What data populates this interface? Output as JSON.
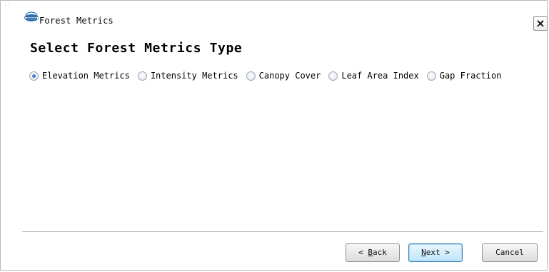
{
  "window": {
    "title": "Forest Metrics",
    "close_label": "×"
  },
  "page": {
    "heading": "Select Forest Metrics Type"
  },
  "metrics_type": {
    "selected": "Elevation Metrics",
    "options": [
      {
        "label": "Elevation Metrics",
        "checked": true
      },
      {
        "label": "Intensity Metrics",
        "checked": false
      },
      {
        "label": "Canopy Cover",
        "checked": false
      },
      {
        "label": "Leaf Area Index",
        "checked": false
      },
      {
        "label": "Gap Fraction",
        "checked": false
      }
    ]
  },
  "buttons": {
    "back": {
      "prefix": "< ",
      "mnemonic": "B",
      "rest": "ack"
    },
    "next": {
      "prefix": "",
      "mnemonic": "N",
      "rest": "ext >"
    },
    "cancel": {
      "label": "Cancel"
    }
  },
  "colors": {
    "radio_selected": "#1f58b8",
    "default_button_border": "#3c7fb1",
    "separator": "#b5b5b5"
  },
  "icons": {
    "app_logo": "app-logo-icon",
    "close": "close-icon"
  }
}
